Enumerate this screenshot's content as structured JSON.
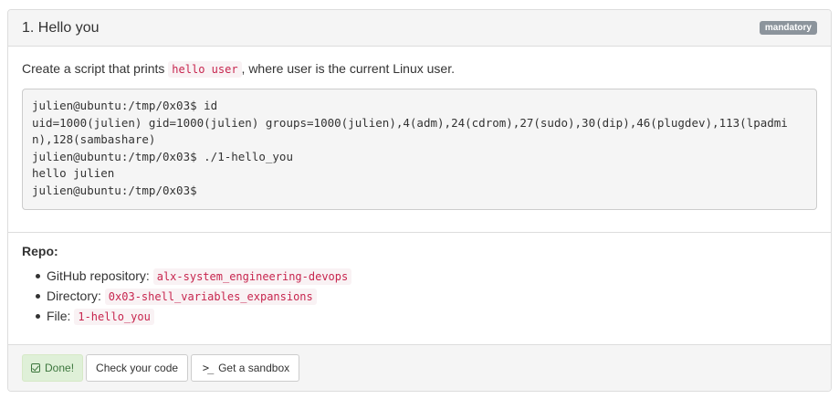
{
  "task": {
    "title": "1. Hello you",
    "badge": "mandatory"
  },
  "description": {
    "before": "Create a script that prints ",
    "code": "hello user",
    "after": ", where user is the current Linux user."
  },
  "terminal": {
    "output": "julien@ubuntu:/tmp/0x03$ id\nuid=1000(julien) gid=1000(julien) groups=1000(julien),4(adm),24(cdrom),27(sudo),30(dip),46(plugdev),113(lpadmin),128(sambashare)\njulien@ubuntu:/tmp/0x03$ ./1-hello_you\nhello julien\njulien@ubuntu:/tmp/0x03$"
  },
  "repo": {
    "title": "Repo:",
    "items": [
      {
        "label": "GitHub repository: ",
        "value": "alx-system_engineering-devops"
      },
      {
        "label": "Directory: ",
        "value": "0x03-shell_variables_expansions"
      },
      {
        "label": "File: ",
        "value": "1-hello_you"
      }
    ]
  },
  "footer": {
    "done_label": "Done!",
    "check_label": "Check your code",
    "sandbox_label": "Get a sandbox"
  },
  "colors": {
    "done_bg": "#dff0d8",
    "done_text": "#3c763d",
    "code_text": "#c7254e",
    "badge_bg": "#8c949c"
  }
}
